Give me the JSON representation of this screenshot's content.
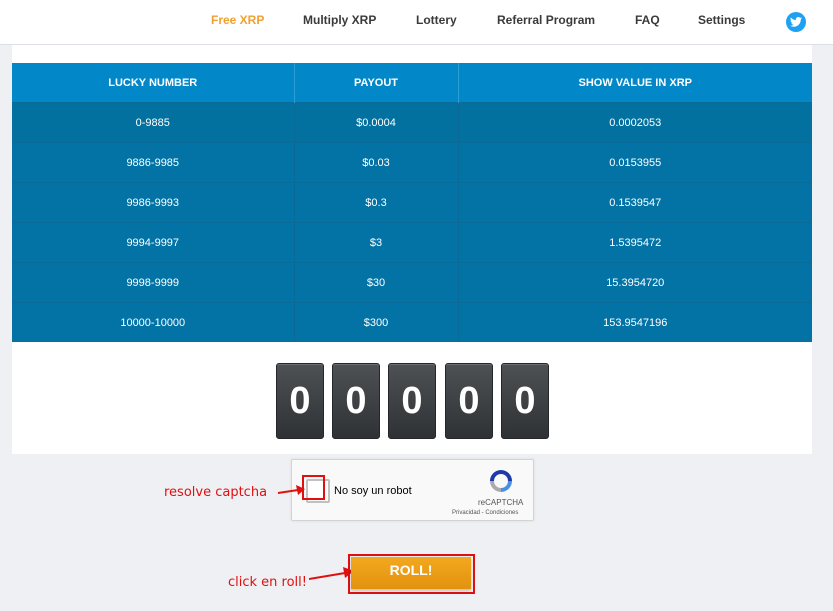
{
  "nav": {
    "items": [
      {
        "label": "Free XRP"
      },
      {
        "label": "Multiply XRP"
      },
      {
        "label": "Lottery"
      },
      {
        "label": "Referral Program"
      },
      {
        "label": "FAQ"
      },
      {
        "label": "Settings"
      }
    ],
    "active_color": "#f0a030",
    "twitter_icon": "twitter-icon"
  },
  "table": {
    "headers": [
      "LUCKY NUMBER",
      "PAYOUT",
      "SHOW VALUE IN XRP"
    ],
    "rows": [
      [
        "0-9885",
        "$0.0004",
        "0.0002053"
      ],
      [
        "9886-9985",
        "$0.03",
        "0.0153955"
      ],
      [
        "9986-9993",
        "$0.3",
        "0.1539547"
      ],
      [
        "9994-9997",
        "$3",
        "1.5395472"
      ],
      [
        "9998-9999",
        "$30",
        "15.3954720"
      ],
      [
        "10000-10000",
        "$300",
        "153.9547196"
      ]
    ]
  },
  "digits": [
    "0",
    "0",
    "0",
    "0",
    "0"
  ],
  "captcha": {
    "label": "No soy un robot",
    "brand": "reCAPTCHA",
    "links": "Privacidad - Condiciones"
  },
  "annotations": {
    "captcha_hint": "resolve captcha",
    "roll_hint": "click en roll!",
    "color": "#e01010"
  },
  "roll_button": {
    "label": "ROLL!"
  }
}
